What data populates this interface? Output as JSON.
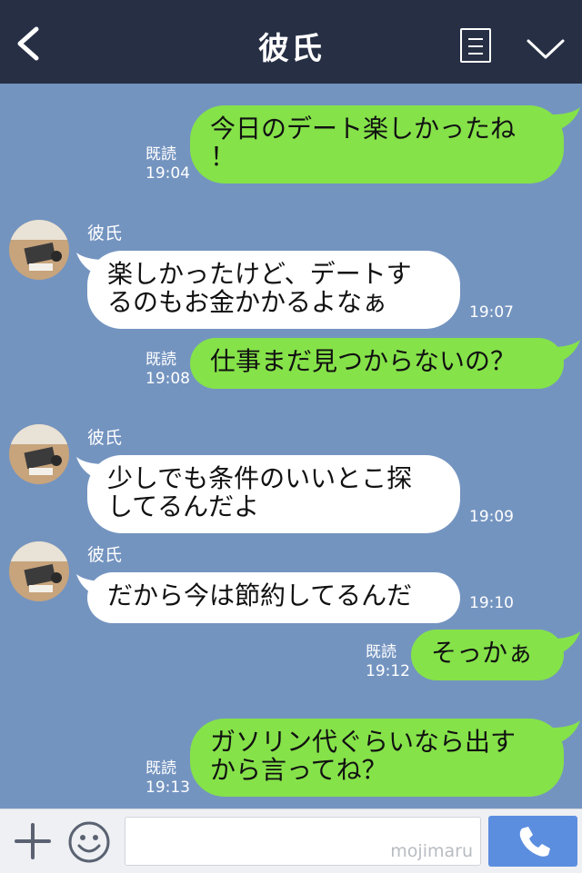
{
  "header": {
    "title": "彼氏"
  },
  "messages": [
    {
      "side": "out",
      "text": "今日のデート楽しかったね\n！",
      "read": "既読",
      "time": "19:04"
    },
    {
      "side": "in",
      "sender": "彼氏",
      "text": "楽しかったけど、デートす\nるのもお金かかるよなぁ",
      "time": "19:07"
    },
    {
      "side": "out",
      "text": "仕事まだ見つからないの？",
      "read": "既読",
      "time": "19:08"
    },
    {
      "side": "in",
      "sender": "彼氏",
      "text": "少しでも条件のいいとこ探\nしてるんだよ",
      "time": "19:09"
    },
    {
      "side": "in",
      "sender": "彼氏",
      "text": "だから今は節約してるんだ",
      "time": "19:10"
    },
    {
      "side": "out",
      "text": "そっかぁ",
      "read": "既読",
      "time": "19:12"
    },
    {
      "side": "out",
      "text": "ガソリン代ぐらいなら出す\nから言ってね？",
      "read": "既読",
      "time": "19:13"
    }
  ],
  "footer": {
    "input_placeholder": "",
    "watermark": "mojimaru"
  },
  "colors": {
    "chat_bg": "#7494c0",
    "header_bg": "#262f44",
    "outgoing_bubble": "#85e249",
    "incoming_bubble": "#ffffff",
    "send_button": "#5c8ee0"
  },
  "icons": {
    "back": "chevron-left-icon",
    "menu": "list-icon",
    "collapse": "chevron-down-icon",
    "add": "plus-icon",
    "emoji": "smiley-icon",
    "send": "phone-icon"
  }
}
